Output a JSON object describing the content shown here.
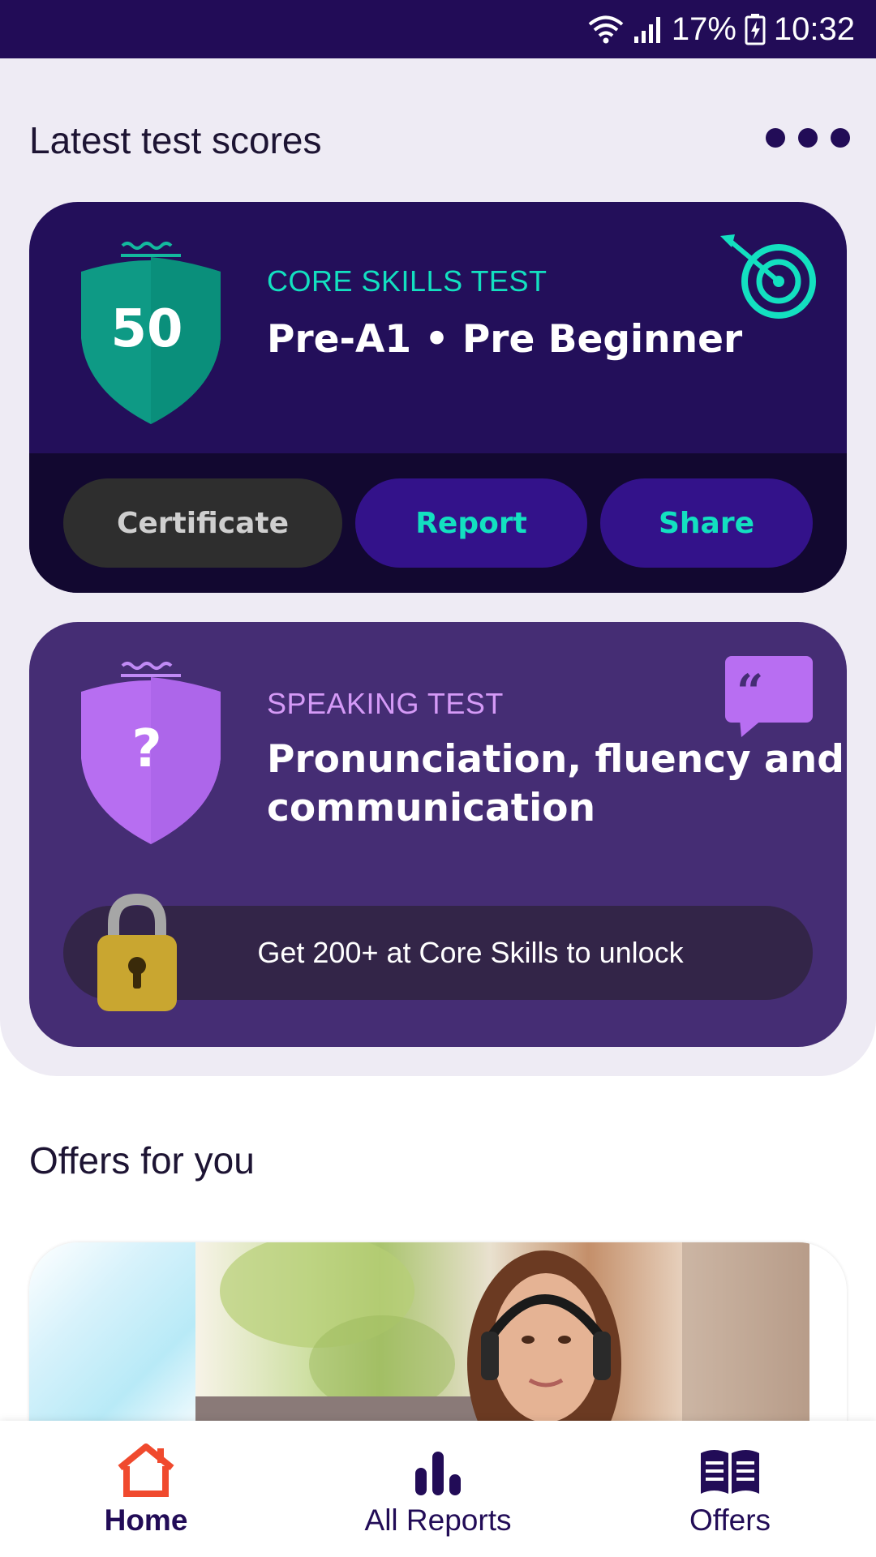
{
  "status_bar": {
    "battery": "17%",
    "time": "10:32",
    "icons": [
      "wifi-icon",
      "signal-icon",
      "battery-icon"
    ]
  },
  "scores": {
    "title": "Latest test scores",
    "more_icon": "more-dots-icon"
  },
  "core_card": {
    "score": "50",
    "kicker": "CORE SKILLS TEST",
    "level": "Pre-A1 • Pre Beginner",
    "icon": "target-icon",
    "buttons": {
      "certificate": "Certificate",
      "report": "Report",
      "share": "Share"
    }
  },
  "speaking_card": {
    "score": "?",
    "kicker": "SPEAKING TEST",
    "heading_line1": "Pronunciation, fluency and",
    "heading_line2": "communication",
    "icon": "quote-bubble-icon",
    "lock_text": "Get 200+ at Core Skills to unlock"
  },
  "offers": {
    "title": "Offers for you"
  },
  "nav": {
    "home": "Home",
    "reports": "All Reports",
    "offers": "Offers"
  },
  "colors": {
    "brand_dark": "#220c57",
    "accent_teal": "#13e0c0",
    "speaking_purple": "#b86ef2",
    "home_red": "#f04a2e"
  }
}
